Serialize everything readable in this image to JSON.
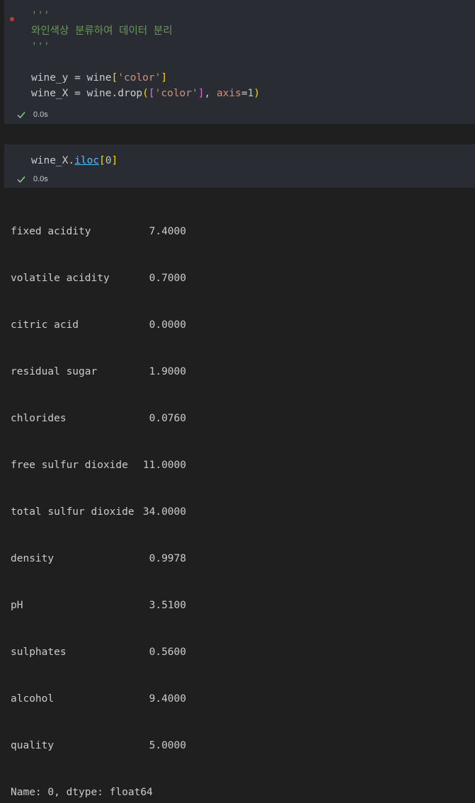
{
  "cell1": {
    "docstring_open": "'''",
    "docstring_text": "와인색상 분류하여 데이터 분리",
    "docstring_close": "'''",
    "line1": {
      "lhs": "wine_y",
      "op": " = ",
      "obj": "wine",
      "key": "'color'"
    },
    "line2": {
      "lhs": "wine_X",
      "op": " = ",
      "call": "wine.drop",
      "list_key": "'color'",
      "sep": ", ",
      "param": "axis",
      "eq": "=",
      "num": "1"
    },
    "status_time": "0.0s"
  },
  "cell2": {
    "var": "wine_X",
    "dot": ".",
    "attr": "iloc",
    "index": "0",
    "status_time": "0.0s"
  },
  "output": {
    "rows": [
      {
        "key": "fixed acidity",
        "value": "7.4000"
      },
      {
        "key": "volatile acidity",
        "value": "0.7000"
      },
      {
        "key": "citric acid",
        "value": "0.0000"
      },
      {
        "key": "residual sugar",
        "value": "1.9000"
      },
      {
        "key": "chlorides",
        "value": "0.0760"
      },
      {
        "key": "free sulfur dioxide",
        "value": "11.0000"
      },
      {
        "key": "total sulfur dioxide",
        "value": "34.0000"
      },
      {
        "key": "density",
        "value": "0.9978"
      },
      {
        "key": "pH",
        "value": "3.5100"
      },
      {
        "key": "sulphates",
        "value": "0.5600"
      },
      {
        "key": "alcohol",
        "value": "9.4000"
      },
      {
        "key": "quality",
        "value": "5.0000"
      }
    ],
    "footer": "Name: 0, dtype: float64"
  },
  "icons": {
    "status": "check-icon",
    "cell_indicator": "unsaved-dot-icon"
  },
  "colors": {
    "background": "#1f1f1f",
    "cell_background": "#292c33",
    "success_check": "#89d185",
    "comment": "#6a9955",
    "string": "#ce9178"
  }
}
